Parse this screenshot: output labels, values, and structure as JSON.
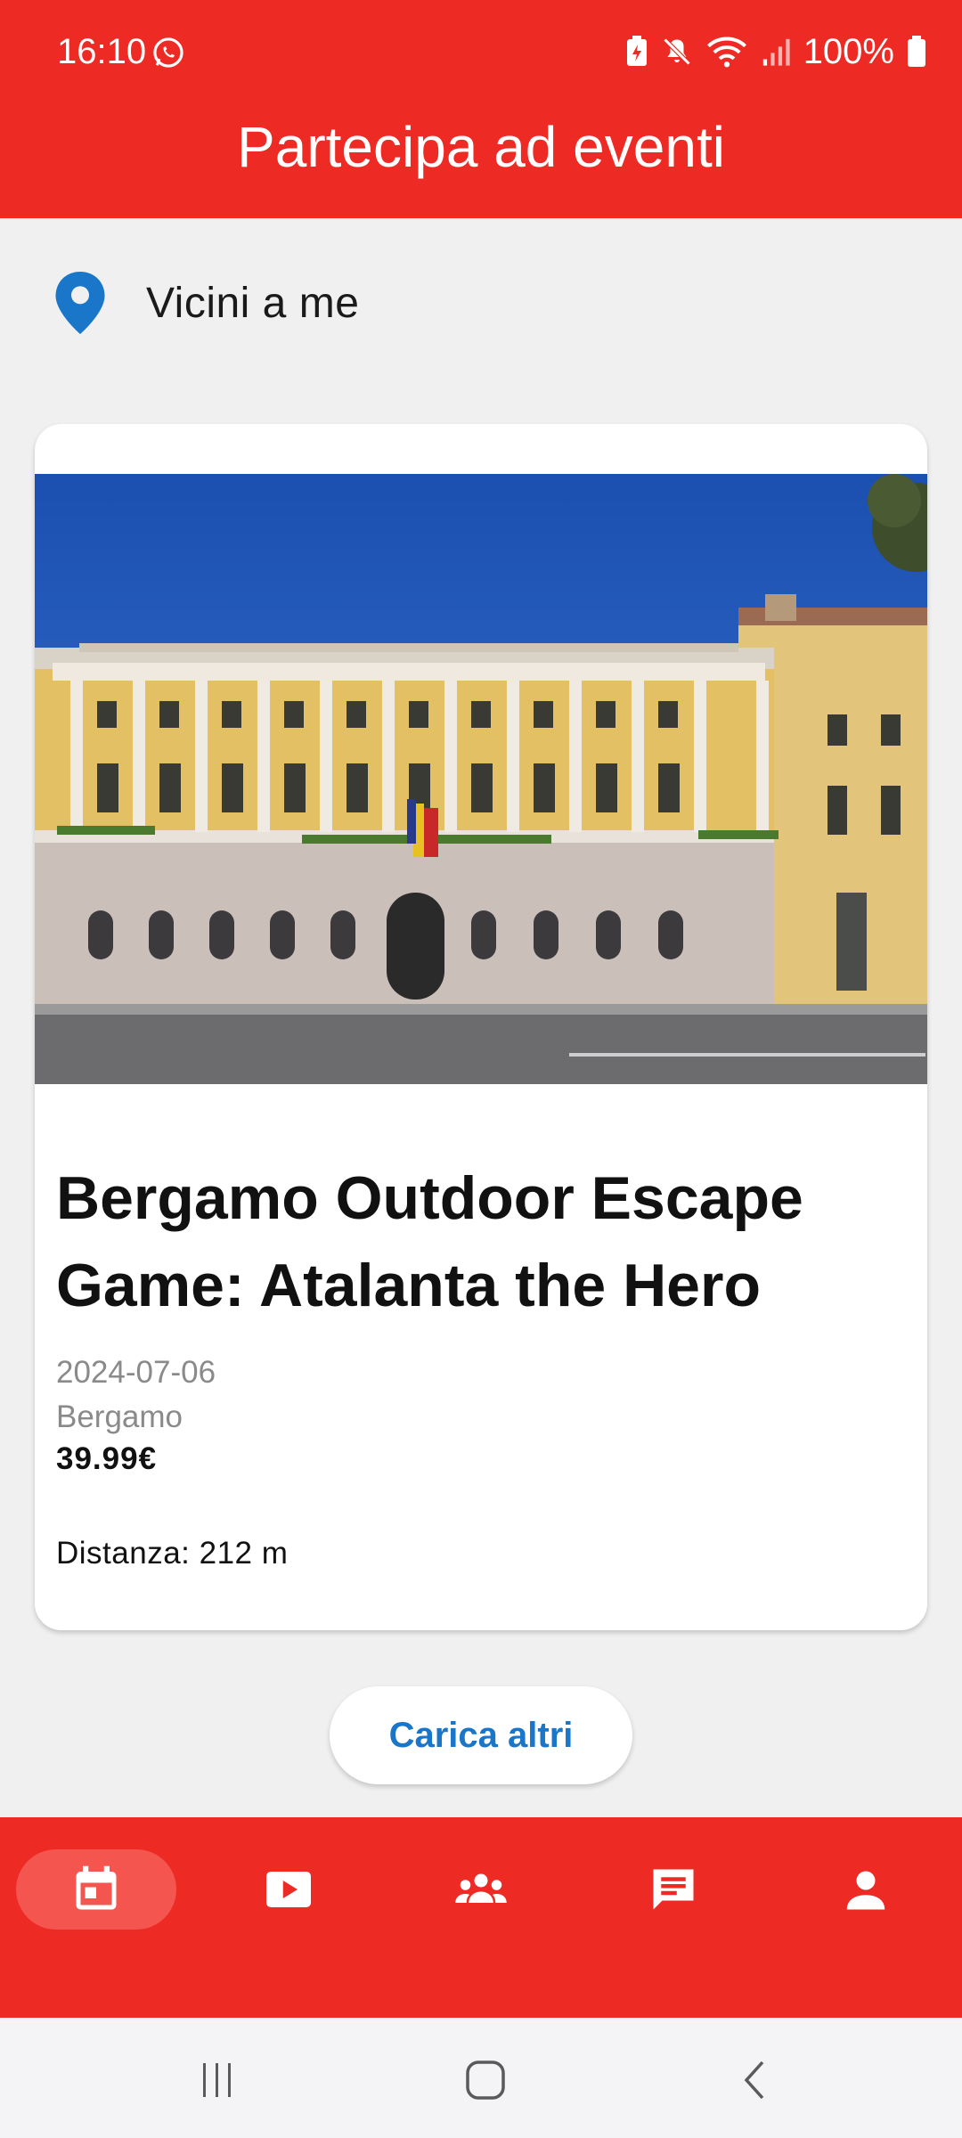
{
  "status_bar": {
    "time": "16:10",
    "battery_text": "100%",
    "icons": [
      "whatsapp-icon",
      "battery-saver-icon",
      "mute-icon",
      "wifi-icon",
      "signal-icon",
      "battery-icon"
    ]
  },
  "app_bar": {
    "title": "Partecipa ad eventi"
  },
  "location": {
    "icon": "location-pin-icon",
    "label": "Vicini a me"
  },
  "events": [
    {
      "title": "Bergamo Outdoor Escape Game: Atalanta the Hero",
      "date": "2024-07-06",
      "city": "Bergamo",
      "price": "39.99€",
      "distance": "Distanza: 212 m"
    }
  ],
  "load_more": {
    "label": "Carica altri"
  },
  "bottom_nav": {
    "items": [
      {
        "icon": "calendar-icon",
        "active": true
      },
      {
        "icon": "video-play-icon",
        "active": false
      },
      {
        "icon": "groups-icon",
        "active": false
      },
      {
        "icon": "chat-icon",
        "active": false
      },
      {
        "icon": "profile-icon",
        "active": false
      }
    ]
  },
  "colors": {
    "primary": "#ee2a24",
    "active_nav": "#f4554f",
    "accent_blue": "#1976c9",
    "background": "#f0f0f0"
  }
}
